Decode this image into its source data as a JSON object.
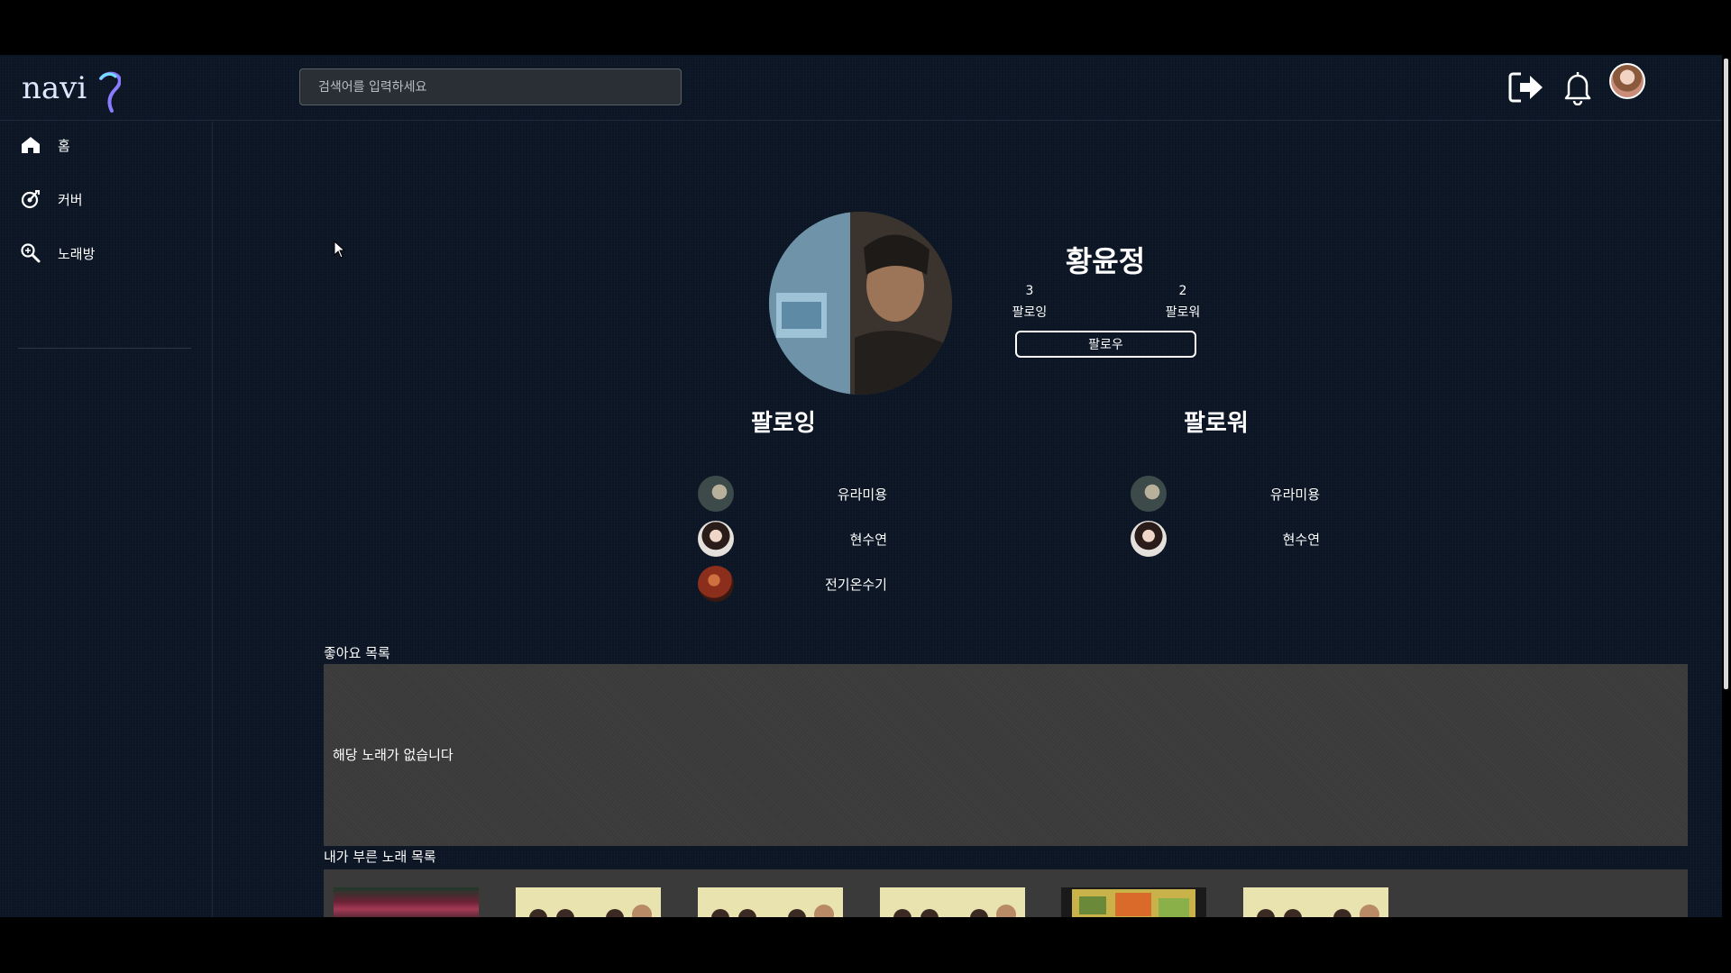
{
  "header": {
    "logo_text": "navi",
    "search_placeholder": "검색어를 입력하세요"
  },
  "sidebar": {
    "items": [
      {
        "label": "홈",
        "icon": "home-icon"
      },
      {
        "label": "커버",
        "icon": "cover-icon"
      },
      {
        "label": "노래방",
        "icon": "karaoke-search-icon"
      }
    ]
  },
  "profile": {
    "name": "황윤정",
    "following_count": "3",
    "following_label": "팔로잉",
    "follower_count": "2",
    "follower_label": "팔로워",
    "follow_button": "팔로우"
  },
  "following": {
    "title": "팔로잉",
    "users": [
      "유라미용",
      "현수연",
      "전기온수기"
    ]
  },
  "followers": {
    "title": "팔로워",
    "users": [
      "유라미용",
      "현수연"
    ]
  },
  "likes": {
    "title": "좋아요 목록",
    "empty_message": "해당 노래가 없습니다"
  },
  "sung": {
    "title": "내가 부른 노래 목록"
  },
  "colors": {
    "background": "#0b1524",
    "panel": "#3a3a3a",
    "accent_logo": "#8a7cff"
  }
}
